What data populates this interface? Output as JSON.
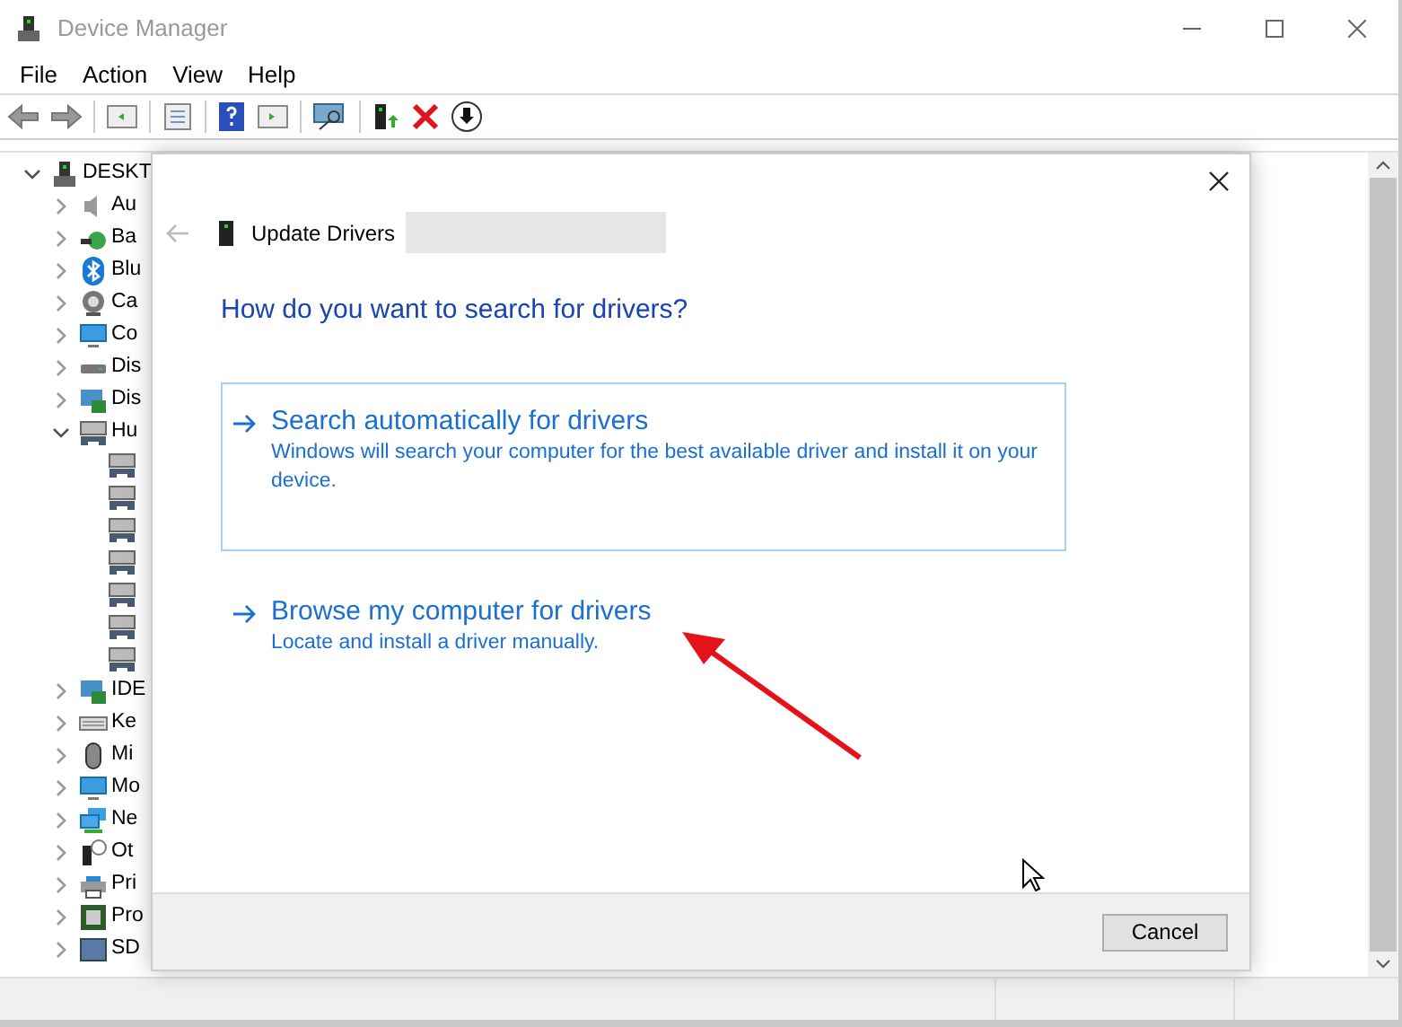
{
  "window": {
    "title": "Device Manager"
  },
  "menu": [
    "File",
    "Action",
    "View",
    "Help"
  ],
  "tree": {
    "label": "DESKT",
    "expanded": true,
    "children": [
      {
        "label": "Au",
        "expanded": false,
        "kind": "speaker"
      },
      {
        "label": "Ba",
        "expanded": false,
        "kind": "battery"
      },
      {
        "label": "Blu",
        "expanded": false,
        "kind": "bluetooth"
      },
      {
        "label": "Ca",
        "expanded": false,
        "kind": "camera"
      },
      {
        "label": "Co",
        "expanded": false,
        "kind": "monitor"
      },
      {
        "label": "Dis",
        "expanded": false,
        "kind": "drive"
      },
      {
        "label": "Dis",
        "expanded": false,
        "kind": "card"
      },
      {
        "label": "Hu",
        "expanded": true,
        "kind": "hid",
        "children": [
          {
            "kind": "hid"
          },
          {
            "kind": "hid"
          },
          {
            "kind": "hid"
          },
          {
            "kind": "hid"
          },
          {
            "kind": "hid"
          },
          {
            "kind": "hid"
          },
          {
            "kind": "hid"
          }
        ]
      },
      {
        "label": "IDE",
        "expanded": false,
        "kind": "card"
      },
      {
        "label": "Ke",
        "expanded": false,
        "kind": "keyboard"
      },
      {
        "label": "Mi",
        "expanded": false,
        "kind": "mouse"
      },
      {
        "label": "Mo",
        "expanded": false,
        "kind": "monitor"
      },
      {
        "label": "Ne",
        "expanded": false,
        "kind": "network"
      },
      {
        "label": "Ot",
        "expanded": false,
        "kind": "unknown"
      },
      {
        "label": "Pri",
        "expanded": false,
        "kind": "printer"
      },
      {
        "label": "Pro",
        "expanded": false,
        "kind": "chip"
      },
      {
        "label": "SD",
        "expanded": false,
        "kind": "sd"
      }
    ]
  },
  "dialog": {
    "title": "Update Drivers",
    "question": "How do you want to search for drivers?",
    "options": [
      {
        "title": "Search automatically for drivers",
        "description": "Windows will search your computer for the best available driver and install it on your device.",
        "selected": true
      },
      {
        "title": "Browse my computer for drivers",
        "description": "Locate and install a driver manually.",
        "selected": false
      }
    ],
    "cancel": "Cancel"
  }
}
